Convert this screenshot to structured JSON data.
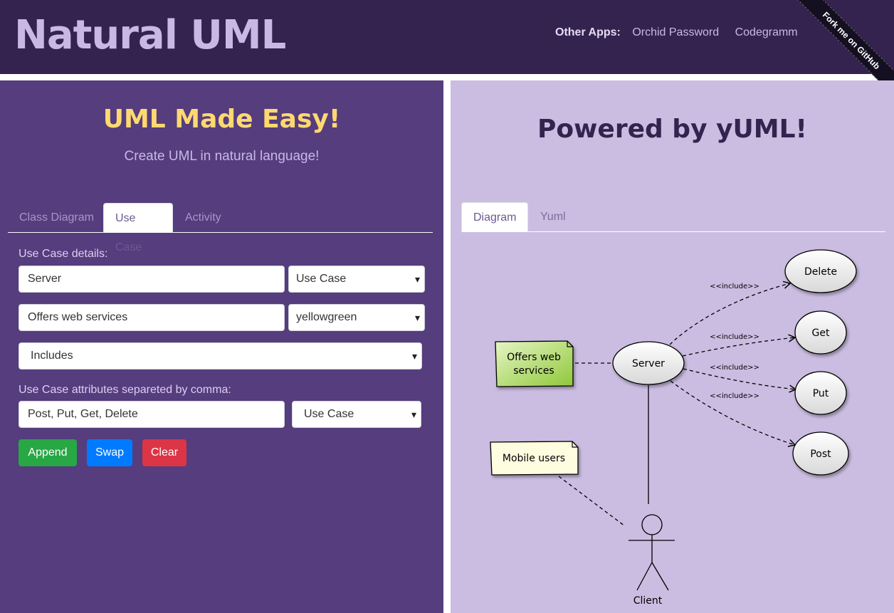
{
  "header": {
    "logo": "Natural UML",
    "other_apps_label": "Other Apps:",
    "links": [
      "Orchid Password",
      "Codegramm"
    ],
    "ribbon": "Fork me on GitHub"
  },
  "left": {
    "title": "UML Made Easy!",
    "subtitle": "Create UML in natural language!",
    "tabs": [
      "Class Diagram",
      "Use Case",
      "Activity"
    ],
    "active_tab": "Use Case",
    "details_label": "Use Case details:",
    "name_value": "Server",
    "name_type": "Use Case",
    "note_value": "Offers web services",
    "note_color": "yellowgreen",
    "relation": "Includes",
    "attrs_label": "Use Case attributes separeted by comma:",
    "attrs_value": "Post, Put, Get, Delete",
    "attrs_type": "Use Case",
    "buttons": {
      "append": "Append",
      "swap": "Swap",
      "clear": "Clear"
    }
  },
  "right": {
    "title": "Powered by yUML!",
    "tabs": [
      "Diagram",
      "Yuml"
    ],
    "active_tab": "Diagram",
    "diagram": {
      "note1": [
        "Offers web",
        "services"
      ],
      "note2": "Mobile users",
      "center": "Server",
      "actor": "Client",
      "edge_label": "<<include>>",
      "use_cases": [
        "Delete",
        "Get",
        "Put",
        "Post"
      ]
    }
  },
  "colors": {
    "header_bg": "#34234f",
    "left_bg": "#553d7e",
    "right_bg": "#cbbde1",
    "title_yellow": "#ffd970",
    "append": "#28a745",
    "swap": "#007bff",
    "clear": "#dc3545",
    "note1_fill": "#9acd32",
    "note2_fill": "#fffde0"
  }
}
